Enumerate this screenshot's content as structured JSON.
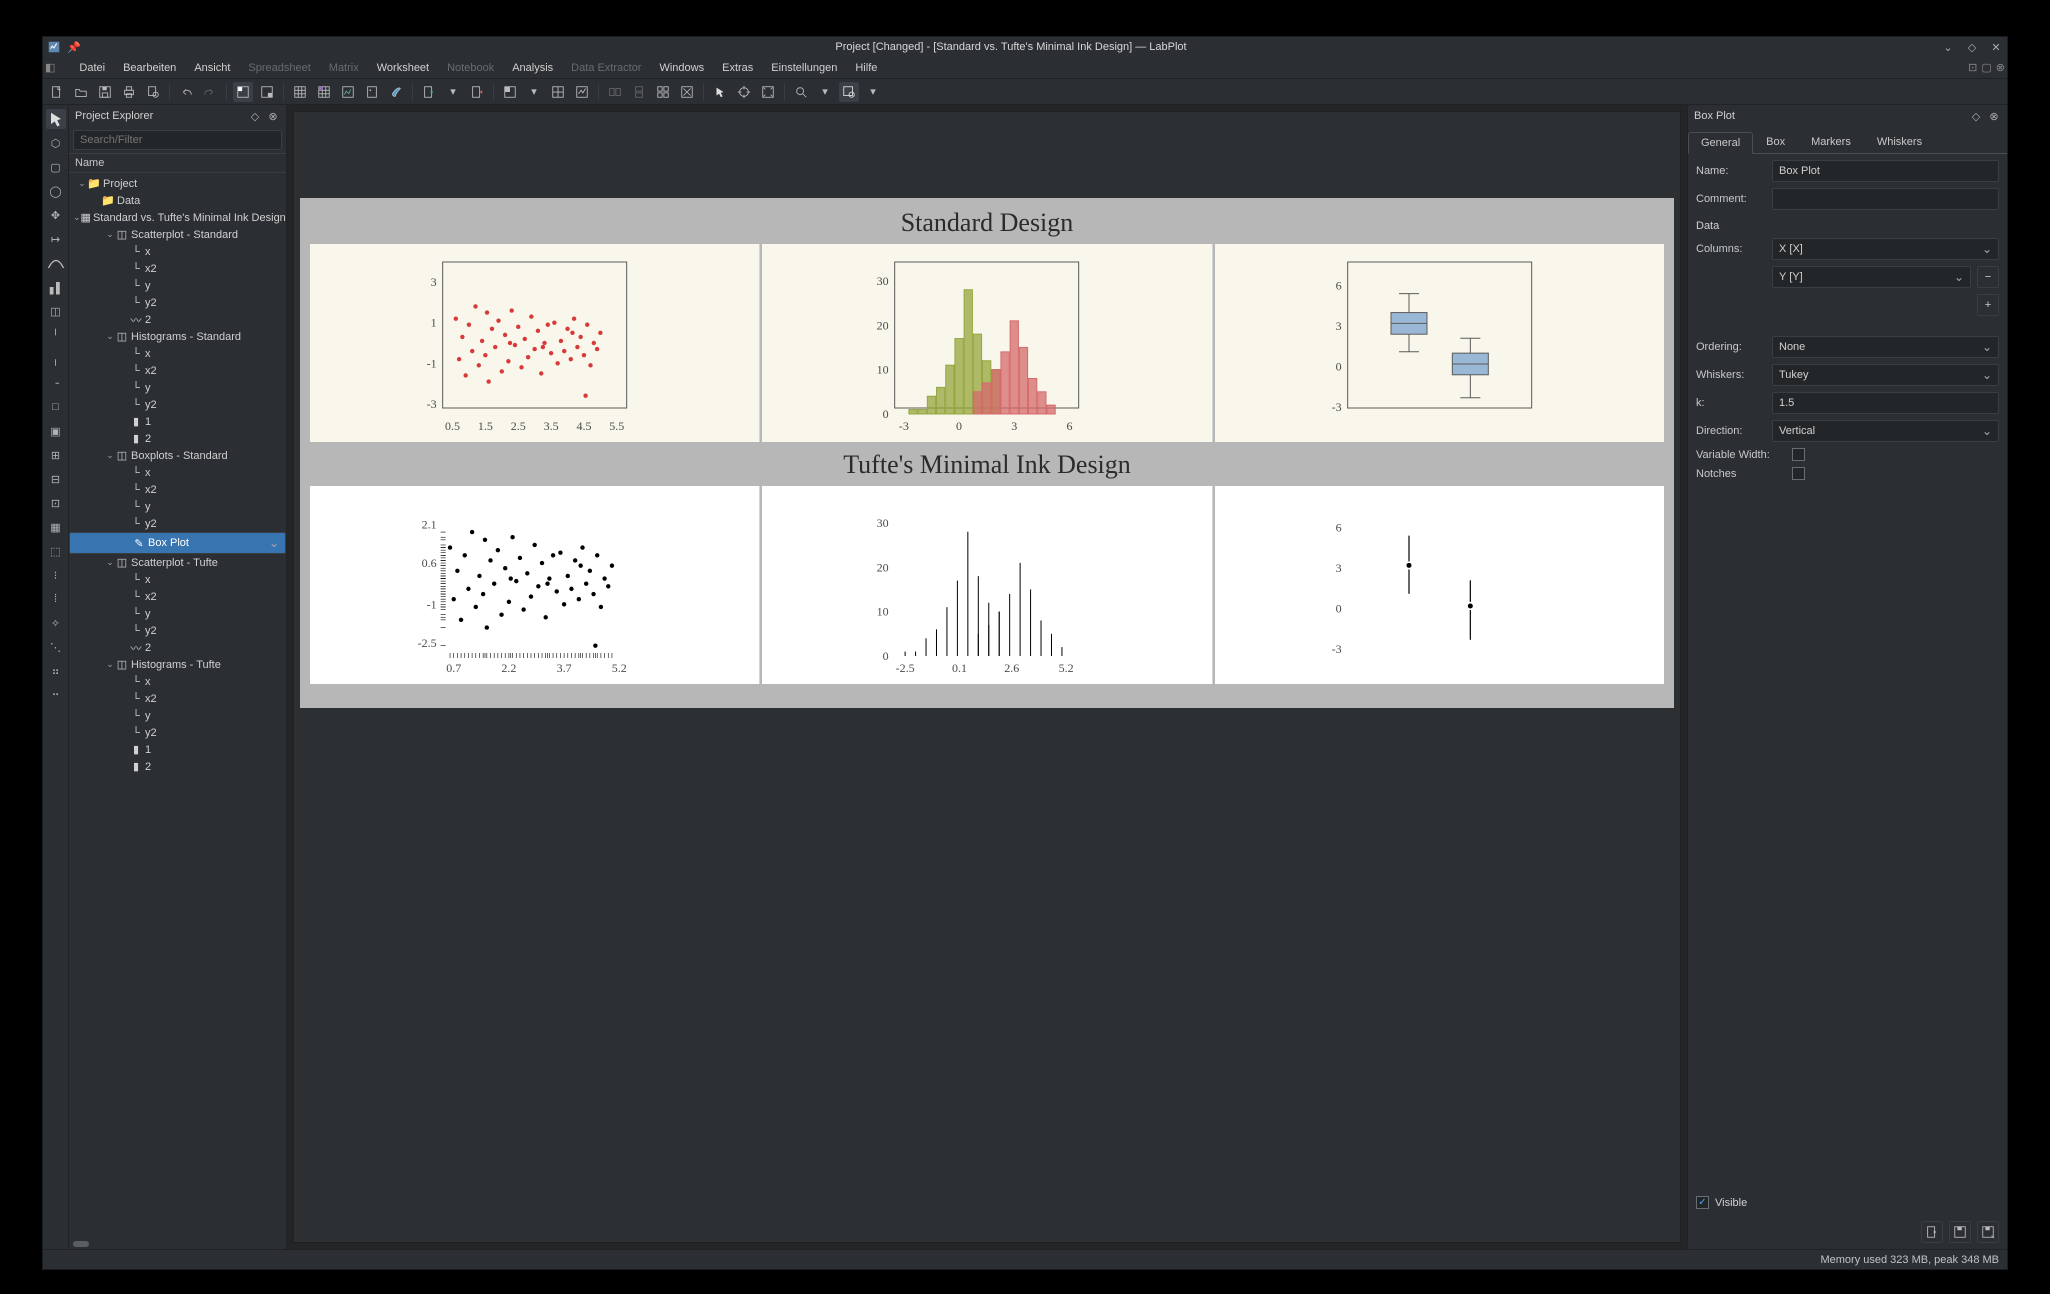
{
  "window_title": "Project [Changed] - [Standard vs. Tufte's Minimal Ink Design] — LabPlot",
  "menus": [
    "Datei",
    "Bearbeiten",
    "Ansicht",
    "Spreadsheet",
    "Matrix",
    "Worksheet",
    "Notebook",
    "Analysis",
    "Data Extractor",
    "Windows",
    "Extras",
    "Einstellungen",
    "Hilfe"
  ],
  "disabled_menus": [
    "Spreadsheet",
    "Matrix",
    "Notebook",
    "Data Extractor"
  ],
  "explorer": {
    "title": "Project Explorer",
    "search_placeholder": "Search/Filter",
    "header": "Name",
    "selected": "Box Plot",
    "tree": [
      {
        "d": 0,
        "tw": "v",
        "ic": "folder",
        "lbl": "Project"
      },
      {
        "d": 1,
        "tw": "",
        "ic": "folder",
        "lbl": "Data"
      },
      {
        "d": 1,
        "tw": "v",
        "ic": "ws",
        "lbl": "Standard vs. Tufte's Minimal Ink Design"
      },
      {
        "d": 2,
        "tw": "v",
        "ic": "plot",
        "lbl": "Scatterplot - Standard"
      },
      {
        "d": 3,
        "tw": "",
        "ic": "ax",
        "lbl": "x"
      },
      {
        "d": 3,
        "tw": "",
        "ic": "ax",
        "lbl": "x2"
      },
      {
        "d": 3,
        "tw": "",
        "ic": "ax",
        "lbl": "y"
      },
      {
        "d": 3,
        "tw": "",
        "ic": "ax",
        "lbl": "y2"
      },
      {
        "d": 3,
        "tw": "",
        "ic": "curve",
        "lbl": "2"
      },
      {
        "d": 2,
        "tw": "v",
        "ic": "plot",
        "lbl": "Histograms - Standard"
      },
      {
        "d": 3,
        "tw": "",
        "ic": "ax",
        "lbl": "x"
      },
      {
        "d": 3,
        "tw": "",
        "ic": "ax",
        "lbl": "x2"
      },
      {
        "d": 3,
        "tw": "",
        "ic": "ax",
        "lbl": "y"
      },
      {
        "d": 3,
        "tw": "",
        "ic": "ax",
        "lbl": "y2"
      },
      {
        "d": 3,
        "tw": "",
        "ic": "hist",
        "lbl": "1"
      },
      {
        "d": 3,
        "tw": "",
        "ic": "hist",
        "lbl": "2"
      },
      {
        "d": 2,
        "tw": "v",
        "ic": "plot",
        "lbl": "Boxplots - Standard"
      },
      {
        "d": 3,
        "tw": "",
        "ic": "ax",
        "lbl": "x"
      },
      {
        "d": 3,
        "tw": "",
        "ic": "ax",
        "lbl": "x2"
      },
      {
        "d": 3,
        "tw": "",
        "ic": "ax",
        "lbl": "y"
      },
      {
        "d": 3,
        "tw": "",
        "ic": "ax",
        "lbl": "y2"
      },
      {
        "d": 3,
        "tw": "",
        "ic": "box",
        "lbl": "Box Plot",
        "sel": true
      },
      {
        "d": 2,
        "tw": "v",
        "ic": "plot",
        "lbl": "Scatterplot - Tufte"
      },
      {
        "d": 3,
        "tw": "",
        "ic": "ax",
        "lbl": "x"
      },
      {
        "d": 3,
        "tw": "",
        "ic": "ax",
        "lbl": "x2"
      },
      {
        "d": 3,
        "tw": "",
        "ic": "ax",
        "lbl": "y"
      },
      {
        "d": 3,
        "tw": "",
        "ic": "ax",
        "lbl": "y2"
      },
      {
        "d": 3,
        "tw": "",
        "ic": "curve",
        "lbl": "2"
      },
      {
        "d": 2,
        "tw": "v",
        "ic": "plot",
        "lbl": "Histograms - Tufte"
      },
      {
        "d": 3,
        "tw": "",
        "ic": "ax",
        "lbl": "x"
      },
      {
        "d": 3,
        "tw": "",
        "ic": "ax",
        "lbl": "x2"
      },
      {
        "d": 3,
        "tw": "",
        "ic": "ax",
        "lbl": "y"
      },
      {
        "d": 3,
        "tw": "",
        "ic": "ax",
        "lbl": "y2"
      },
      {
        "d": 3,
        "tw": "",
        "ic": "hist",
        "lbl": "1"
      },
      {
        "d": 3,
        "tw": "",
        "ic": "hist",
        "lbl": "2"
      }
    ]
  },
  "properties": {
    "title": "Box Plot",
    "tabs": [
      "General",
      "Box",
      "Markers",
      "Whiskers"
    ],
    "active_tab": "General",
    "name_label": "Name:",
    "name_value": "Box Plot",
    "comment_label": "Comment:",
    "comment_value": "",
    "data_label": "Data",
    "columns_label": "Columns:",
    "column1": "X [X]",
    "column2": "Y [Y]",
    "ordering_label": "Ordering:",
    "ordering_value": "None",
    "whiskers_label": "Whiskers:",
    "whiskers_value": "Tukey",
    "k_label": "k:",
    "k_value": "1.5",
    "direction_label": "Direction:",
    "direction_value": "Vertical",
    "varwidth_label": "Variable Width:",
    "varwidth_checked": false,
    "notches_label": "Notches",
    "notches_checked": false,
    "visible_label": "Visible",
    "visible_checked": true
  },
  "worksheet": {
    "title_standard": "Standard Design",
    "title_tufte": "Tufte's Minimal Ink Design"
  },
  "chart_data": [
    {
      "name": "Scatterplot - Standard",
      "type": "scatter",
      "color": "#d83a3a",
      "x_ticks": [
        0.5,
        1.5,
        2.5,
        3.5,
        4.5,
        5.5
      ],
      "y_ticks": [
        -3,
        -1,
        1,
        3
      ],
      "xlim": [
        0.2,
        5.8
      ],
      "ylim": [
        -3.5,
        3.5
      ],
      "points": [
        [
          0.6,
          1.2
        ],
        [
          0.7,
          -0.8
        ],
        [
          0.8,
          0.3
        ],
        [
          0.9,
          -1.6
        ],
        [
          1.0,
          0.9
        ],
        [
          1.1,
          -0.4
        ],
        [
          1.2,
          1.8
        ],
        [
          1.3,
          -1.1
        ],
        [
          1.4,
          0.1
        ],
        [
          1.5,
          -0.6
        ],
        [
          1.55,
          1.5
        ],
        [
          1.6,
          -1.9
        ],
        [
          1.7,
          0.7
        ],
        [
          1.8,
          -0.2
        ],
        [
          1.9,
          1.1
        ],
        [
          2.0,
          -1.4
        ],
        [
          2.1,
          0.4
        ],
        [
          2.2,
          -0.9
        ],
        [
          2.25,
          0.0
        ],
        [
          2.3,
          1.6
        ],
        [
          2.4,
          -0.1
        ],
        [
          2.5,
          0.8
        ],
        [
          2.6,
          -1.2
        ],
        [
          2.7,
          0.2
        ],
        [
          2.8,
          -0.7
        ],
        [
          2.9,
          1.3
        ],
        [
          3.0,
          -0.3
        ],
        [
          3.1,
          0.6
        ],
        [
          3.2,
          -1.5
        ],
        [
          3.25,
          -0.2
        ],
        [
          3.3,
          0.0
        ],
        [
          3.4,
          0.9
        ],
        [
          3.5,
          -0.5
        ],
        [
          3.6,
          1.0
        ],
        [
          3.7,
          -1.0
        ],
        [
          3.8,
          0.1
        ],
        [
          3.9,
          -0.4
        ],
        [
          4.0,
          0.7
        ],
        [
          4.1,
          -0.8
        ],
        [
          4.15,
          0.5
        ],
        [
          4.2,
          1.2
        ],
        [
          4.3,
          -0.2
        ],
        [
          4.4,
          0.3
        ],
        [
          4.5,
          -0.6
        ],
        [
          4.55,
          -2.6
        ],
        [
          4.6,
          0.9
        ],
        [
          4.7,
          -1.1
        ],
        [
          4.8,
          0.0
        ],
        [
          4.9,
          -0.3
        ],
        [
          5.0,
          0.5
        ]
      ]
    },
    {
      "name": "Histograms - Standard",
      "type": "bar",
      "x_ticks": [
        -3,
        0,
        3,
        6
      ],
      "y_ticks": [
        0,
        10,
        20,
        30
      ],
      "xlim": [
        -3.5,
        6.5
      ],
      "ylim": [
        0,
        32
      ],
      "series": [
        {
          "name": "1",
          "color": "#95a63e",
          "bars": [
            [
              -2.5,
              1
            ],
            [
              -2.0,
              1
            ],
            [
              -1.5,
              4
            ],
            [
              -1.0,
              6
            ],
            [
              -0.5,
              11
            ],
            [
              0.0,
              17
            ],
            [
              0.5,
              28
            ],
            [
              1.0,
              18
            ],
            [
              1.5,
              12
            ],
            [
              2.0,
              10
            ]
          ]
        },
        {
          "name": "2",
          "color": "#d46a6a",
          "bars": [
            [
              1.0,
              5
            ],
            [
              1.5,
              7
            ],
            [
              2.0,
              10
            ],
            [
              2.5,
              14
            ],
            [
              3.0,
              21
            ],
            [
              3.5,
              15
            ],
            [
              4.0,
              8
            ],
            [
              4.5,
              5
            ],
            [
              5.0,
              2
            ]
          ]
        }
      ]
    },
    {
      "name": "Boxplots - Standard",
      "type": "box",
      "y_ticks": [
        -3,
        0,
        3,
        6
      ],
      "ylim": [
        -3.5,
        7
      ],
      "series": [
        {
          "name": "X",
          "pos": 1,
          "min": 1.1,
          "q1": 2.4,
          "median": 3.2,
          "q3": 4.0,
          "max": 5.4,
          "color": "#9bb7d6"
        },
        {
          "name": "Y",
          "pos": 2,
          "min": -2.3,
          "q1": -0.6,
          "median": 0.2,
          "q3": 1.0,
          "max": 2.1,
          "color": "#9bb7d6"
        }
      ]
    },
    {
      "name": "Scatterplot - Tufte",
      "type": "scatter",
      "color": "#000000",
      "x_ticks": [
        0.7,
        2.2,
        3.7,
        5.2
      ],
      "y_ticks": [
        -2.5,
        -1.0,
        0.6,
        2.1
      ],
      "xlim": [
        0.4,
        5.4
      ],
      "ylim": [
        -3.0,
        2.5
      ],
      "rug": true,
      "points": [
        [
          0.6,
          1.2
        ],
        [
          0.7,
          -0.8
        ],
        [
          0.8,
          0.3
        ],
        [
          0.9,
          -1.6
        ],
        [
          1.0,
          0.9
        ],
        [
          1.1,
          -0.4
        ],
        [
          1.2,
          1.8
        ],
        [
          1.3,
          -1.1
        ],
        [
          1.4,
          0.1
        ],
        [
          1.5,
          -0.6
        ],
        [
          1.55,
          1.5
        ],
        [
          1.6,
          -1.9
        ],
        [
          1.7,
          0.7
        ],
        [
          1.8,
          -0.2
        ],
        [
          1.9,
          1.1
        ],
        [
          2.0,
          -1.4
        ],
        [
          2.1,
          0.4
        ],
        [
          2.2,
          -0.9
        ],
        [
          2.25,
          0.0
        ],
        [
          2.3,
          1.6
        ],
        [
          2.4,
          -0.1
        ],
        [
          2.5,
          0.8
        ],
        [
          2.6,
          -1.2
        ],
        [
          2.7,
          0.2
        ],
        [
          2.8,
          -0.7
        ],
        [
          2.9,
          1.3
        ],
        [
          3.0,
          -0.3
        ],
        [
          3.1,
          0.6
        ],
        [
          3.2,
          -1.5
        ],
        [
          3.25,
          -0.2
        ],
        [
          3.3,
          0.0
        ],
        [
          3.4,
          0.9
        ],
        [
          3.5,
          -0.5
        ],
        [
          3.6,
          1.0
        ],
        [
          3.7,
          -1.0
        ],
        [
          3.8,
          0.1
        ],
        [
          3.9,
          -0.4
        ],
        [
          4.0,
          0.7
        ],
        [
          4.1,
          -0.8
        ],
        [
          4.15,
          0.5
        ],
        [
          4.2,
          1.2
        ],
        [
          4.3,
          -0.2
        ],
        [
          4.4,
          0.3
        ],
        [
          4.5,
          -0.6
        ],
        [
          4.55,
          -2.6
        ],
        [
          4.6,
          0.9
        ],
        [
          4.7,
          -1.1
        ],
        [
          4.8,
          0.0
        ],
        [
          4.9,
          -0.3
        ],
        [
          5.0,
          0.5
        ]
      ]
    },
    {
      "name": "Histograms - Tufte",
      "type": "bar-line",
      "x_ticks": [
        -2.5,
        0.1,
        2.6,
        5.2
      ],
      "y_ticks": [
        0,
        10,
        20,
        30
      ],
      "xlim": [
        -3.0,
        5.8
      ],
      "ylim": [
        0,
        32
      ],
      "bars": [
        [
          -2.5,
          1
        ],
        [
          -2.0,
          1
        ],
        [
          -1.5,
          4
        ],
        [
          -1.0,
          6
        ],
        [
          -0.5,
          11
        ],
        [
          0.0,
          17
        ],
        [
          0.5,
          28
        ],
        [
          1.0,
          18
        ],
        [
          1.5,
          12
        ],
        [
          2.0,
          10
        ],
        [
          1.0,
          5
        ],
        [
          1.5,
          7
        ],
        [
          2.0,
          10
        ],
        [
          2.5,
          14
        ],
        [
          3.0,
          21
        ],
        [
          3.5,
          15
        ],
        [
          4.0,
          8
        ],
        [
          4.5,
          5
        ],
        [
          5.0,
          2
        ]
      ]
    },
    {
      "name": "Boxplots - Tufte",
      "type": "line-box",
      "y_ticks": [
        -3,
        0,
        3,
        6
      ],
      "ylim": [
        -3.5,
        7
      ],
      "series": [
        {
          "pos": 1,
          "low": 1.1,
          "gap_lo": 2.9,
          "dot": 3.2,
          "gap_hi": 3.5,
          "high": 5.4
        },
        {
          "pos": 2,
          "low": -2.3,
          "gap_lo": -0.1,
          "dot": 0.2,
          "gap_hi": 0.5,
          "high": 2.1
        }
      ]
    }
  ],
  "status": "Memory used 323 MB, peak 348 MB"
}
